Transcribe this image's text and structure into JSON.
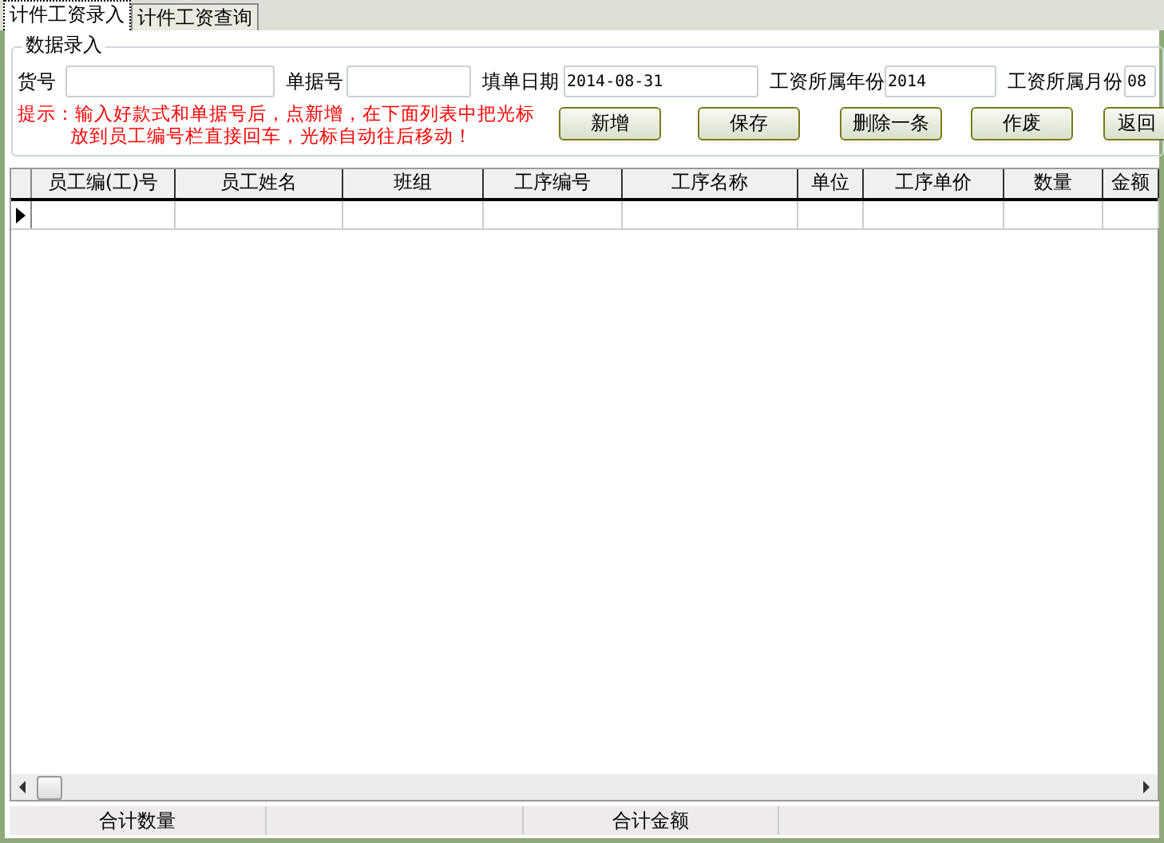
{
  "tabs": [
    {
      "label": "计件工资录入",
      "selected": true
    },
    {
      "label": "计件工资查询",
      "selected": false
    }
  ],
  "group": {
    "title": "数据录入"
  },
  "fields": [
    {
      "label": "货号"
    },
    {
      "label": "单据号"
    },
    {
      "label": "填单日期",
      "value": "2014-08-31"
    },
    {
      "label": "工资所属年份",
      "value": "2014"
    },
    {
      "label": "工资所属月份",
      "value": "08"
    }
  ],
  "hint": [
    "提示：输入好款式和单据号后，点新增，在下面列表中把光标",
    "放到员工编号栏直接回车，光标自动往后移动！"
  ],
  "buttons": [
    "新增",
    "保存",
    "删除一条",
    "作废",
    "返回"
  ],
  "table": {
    "columns": [
      "员工编(工)号",
      "员工姓名",
      "班组",
      "工序编号",
      "工序名称",
      "单位",
      "工序单价",
      "数量",
      "金额"
    ],
    "rows": [
      {
        "current": true
      }
    ]
  },
  "footer": [
    {
      "label": "合计数量"
    },
    {
      "label": "合计金额"
    }
  ]
}
